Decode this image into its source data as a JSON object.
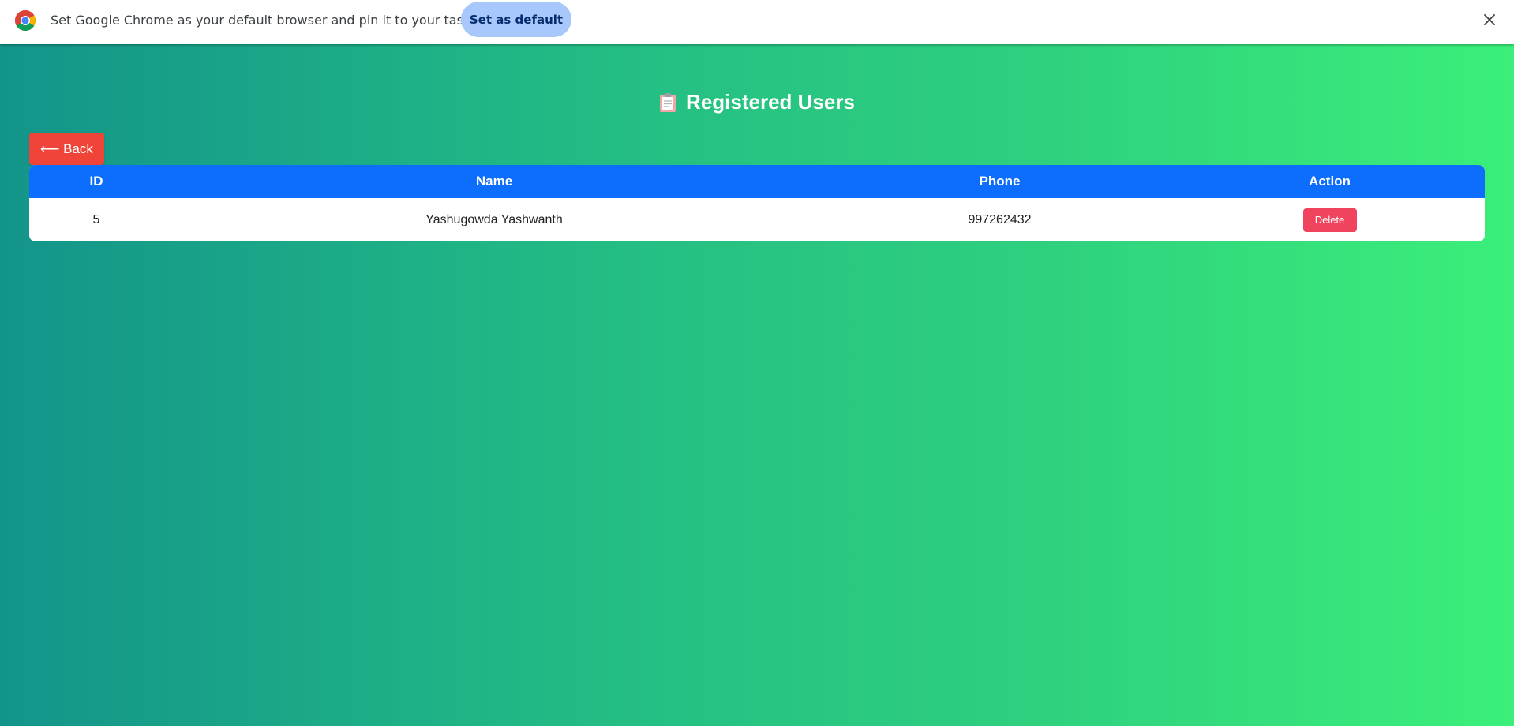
{
  "infobar": {
    "message": "Set Google Chrome as your default browser and pin it to your taskbar",
    "set_default_label": "Set as default",
    "close_icon": "close-icon",
    "logo_icon": "chrome-logo-icon"
  },
  "page": {
    "title": "Registered Users",
    "title_icon": "clipboard-icon",
    "back_label": "⟵ Back",
    "gradient_colors": [
      "#13948a",
      "#3bef7a"
    ],
    "accent_header": "#0d6efd",
    "back_color": "#f04438",
    "delete_color": "#f0445e"
  },
  "table": {
    "headers": [
      "ID",
      "Name",
      "Phone",
      "Action"
    ],
    "rows": [
      {
        "id": "5",
        "name": "Yashugowda Yashwanth",
        "phone": "997262432",
        "action_label": "Delete"
      }
    ]
  }
}
